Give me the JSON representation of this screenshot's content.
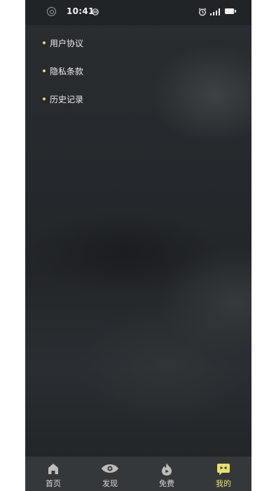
{
  "status_bar": {
    "time": "10:41"
  },
  "menu": {
    "items": [
      {
        "label": "用户协议"
      },
      {
        "label": "隐私条款"
      },
      {
        "label": "历史记录"
      }
    ]
  },
  "bottom_nav": {
    "items": [
      {
        "label": "首页",
        "icon": "home-icon"
      },
      {
        "label": "发现",
        "icon": "eye-icon"
      },
      {
        "label": "免费",
        "icon": "flame-play-icon"
      },
      {
        "label": "我的",
        "icon": "smiley-chat-icon"
      }
    ],
    "active_index": 3
  },
  "colors": {
    "accent": "#e7e26a",
    "background": "#25292d",
    "nav_background": "#35383b"
  }
}
